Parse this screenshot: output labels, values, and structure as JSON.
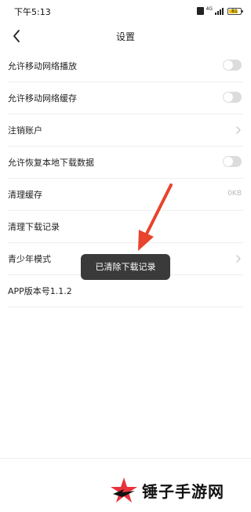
{
  "status_bar": {
    "time": "下午5:13",
    "network_label": "4G",
    "battery_level": "81",
    "battery_color": "#f2c200"
  },
  "header": {
    "title": "设置",
    "back_icon": "chevron-left-icon"
  },
  "settings": [
    {
      "label": "允许移动网络播放",
      "control": "toggle",
      "state": "off"
    },
    {
      "label": "允许移动网络缓存",
      "control": "toggle",
      "state": "off"
    },
    {
      "label": "注销账户",
      "control": "chevron"
    },
    {
      "label": "允许恢复本地下载数据",
      "control": "toggle",
      "state": "off"
    },
    {
      "label": "清理缓存",
      "control": "value",
      "value": "0KB"
    },
    {
      "label": "清理下载记录",
      "control": "none"
    },
    {
      "label": "青少年模式",
      "control": "chevron"
    },
    {
      "label": "APP版本号1.1.2",
      "control": "none"
    }
  ],
  "toast": {
    "text": "已清除下载记录"
  },
  "annotation": {
    "arrow_color": "#e8432c"
  },
  "watermark": {
    "text": "锤子手游网",
    "logo_color": "#e8323c"
  }
}
